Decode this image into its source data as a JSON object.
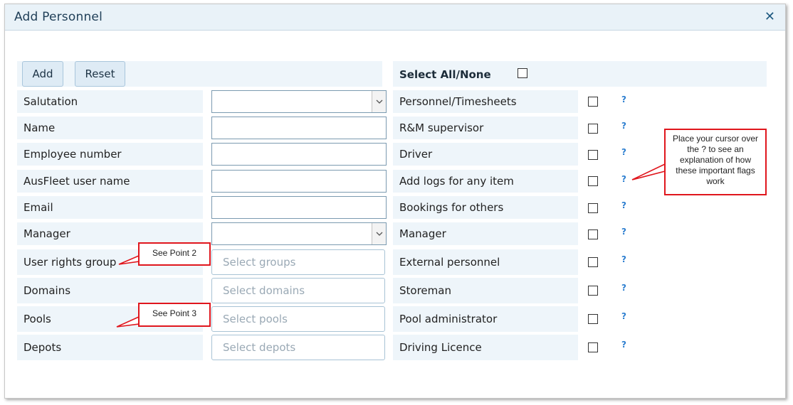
{
  "dialog": {
    "title": "Add Personnel",
    "close_glyph": "✕"
  },
  "toolbar": {
    "add_label": "Add",
    "reset_label": "Reset"
  },
  "left_fields": [
    {
      "label": "Salutation",
      "kind": "select",
      "value": ""
    },
    {
      "label": "Name",
      "kind": "text",
      "value": ""
    },
    {
      "label": "Employee number",
      "kind": "text",
      "value": ""
    },
    {
      "label": "AusFleet user name",
      "kind": "text",
      "value": ""
    },
    {
      "label": "Email",
      "kind": "text",
      "value": ""
    },
    {
      "label": "Manager",
      "kind": "select",
      "value": ""
    },
    {
      "label": "User rights group",
      "kind": "multi",
      "placeholder": "Select groups"
    },
    {
      "label": "Domains",
      "kind": "multi",
      "placeholder": "Select domains"
    },
    {
      "label": "Pools",
      "kind": "multi",
      "placeholder": "Select pools"
    },
    {
      "label": "Depots",
      "kind": "multi",
      "placeholder": "Select depots"
    }
  ],
  "flags": {
    "select_all_label": "Select All/None",
    "help_glyph": "?",
    "items": [
      {
        "label": "Personnel/Timesheets",
        "checked": false
      },
      {
        "label": "R&M supervisor",
        "checked": false
      },
      {
        "label": "Driver",
        "checked": false
      },
      {
        "label": "Add logs for any item",
        "checked": false
      },
      {
        "label": "Bookings for others",
        "checked": false
      },
      {
        "label": "Manager",
        "checked": false
      },
      {
        "label": "External personnel",
        "checked": false
      },
      {
        "label": "Storeman",
        "checked": false
      },
      {
        "label": "Pool administrator",
        "checked": false
      },
      {
        "label": "Driving Licence",
        "checked": false
      }
    ]
  },
  "callouts": {
    "point2": "See Point 2",
    "point3": "See Point 3",
    "flags_help": "Place your cursor over the ? to see an explanation of how these important flags work"
  },
  "colors": {
    "cell_bg": "#eef5fa",
    "title_bg": "#e9f2f8",
    "help": "#2e7fd0",
    "callout_border": "#e0161d"
  }
}
